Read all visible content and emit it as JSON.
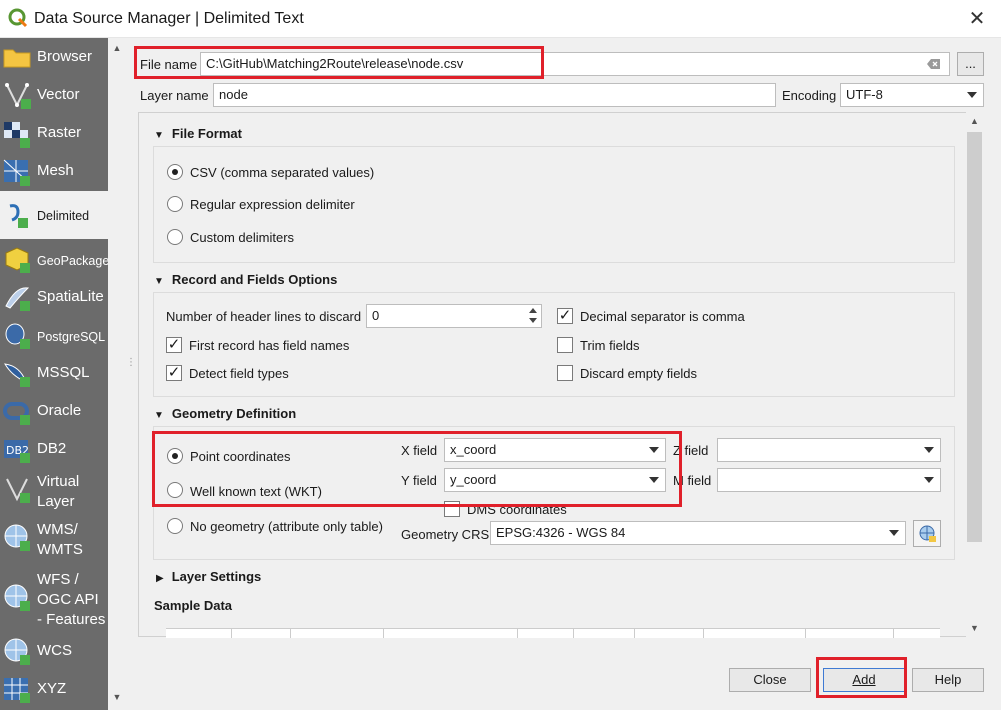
{
  "window": {
    "title": "Data Source Manager | Delimited Text",
    "close_glyph": "✕"
  },
  "sidebar": {
    "items": [
      {
        "label": "Browser",
        "icon": "folder-icon"
      },
      {
        "label": "Vector",
        "icon": "vector-icon"
      },
      {
        "label": "Raster",
        "icon": "raster-icon"
      },
      {
        "label": "Mesh",
        "icon": "mesh-icon"
      },
      {
        "label": "Delimited",
        "icon": "delimited-icon"
      },
      {
        "label": "GeoPackage",
        "icon": "geopackage-icon"
      },
      {
        "label": "SpatiaLite",
        "icon": "spatialite-icon"
      },
      {
        "label": "PostgreSQL",
        "icon": "postgresql-icon"
      },
      {
        "label": "MSSQL",
        "icon": "mssql-icon"
      },
      {
        "label": "Oracle",
        "icon": "oracle-icon"
      },
      {
        "label": "DB2",
        "icon": "db2-icon"
      },
      {
        "label": "Virtual Layer",
        "icon": "virtual-layer-icon"
      },
      {
        "label": "WMS/ WMTS",
        "icon": "wms-icon"
      },
      {
        "label": "WFS / OGC API - Features",
        "icon": "wfs-icon"
      },
      {
        "label": "WCS",
        "icon": "wcs-icon"
      },
      {
        "label": "XYZ",
        "icon": "xyz-icon"
      }
    ]
  },
  "file": {
    "label": "File name",
    "value": "C:\\GitHub\\Matching2Route\\release\\node.csv",
    "browse": "..."
  },
  "layer": {
    "label": "Layer name",
    "value": "node",
    "encoding_label": "Encoding",
    "encoding_value": "UTF-8"
  },
  "file_format": {
    "header": "File Format",
    "options": [
      "CSV (comma separated values)",
      "Regular expression delimiter",
      "Custom delimiters"
    ],
    "selected": 0
  },
  "record_options": {
    "header": "Record and Fields Options",
    "header_lines_label": "Number of header lines to discard",
    "header_lines_value": "0",
    "first_record": "First record has field names",
    "detect_types": "Detect field types",
    "decimal_comma": "Decimal separator is comma",
    "trim_fields": "Trim fields",
    "discard_empty": "Discard empty fields"
  },
  "geometry": {
    "header": "Geometry Definition",
    "point": "Point coordinates",
    "wkt": "Well known text (WKT)",
    "none": "No geometry (attribute only table)",
    "x_label": "X field",
    "x_value": "x_coord",
    "y_label": "Y field",
    "y_value": "y_coord",
    "z_label": "Z field",
    "m_label": "M field",
    "dms": "DMS coordinates",
    "crs_label": "Geometry CRS",
    "crs_value": "EPSG:4326 - WGS 84"
  },
  "layer_settings": {
    "header": "Layer Settings"
  },
  "sample": {
    "header": "Sample Data"
  },
  "footer": {
    "close": "Close",
    "add": "Add",
    "help": "Help"
  },
  "colors": {
    "highlight": "#e0202a",
    "sidebar_bg": "#6b6b6b"
  }
}
